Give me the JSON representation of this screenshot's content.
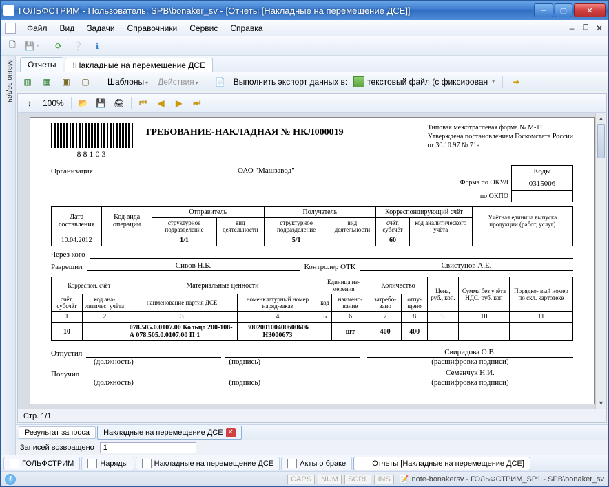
{
  "title": "ГОЛЬФСТРИМ - Пользователь: SPB\\bonaker_sv - [Отчеты  [Накладные на перемещение ДСЕ]]",
  "menu": {
    "file": "Файл",
    "view": "Вид",
    "tasks": "Задачи",
    "refs": "Справочники",
    "service": "Сервис",
    "help": "Справка"
  },
  "side_tab": "Меню задач",
  "upper_tabs": {
    "reports": "Отчеты",
    "invoices": "!Накладные на перемещение ДСЕ"
  },
  "tool": {
    "templates": "Шаблоны",
    "actions": "Действия",
    "export_label": "Выполнить экспорт данных в:",
    "export_target": "текстовый файл (с фиксирован"
  },
  "preview": {
    "zoom": "100%"
  },
  "doc": {
    "barcode_num": "88103",
    "title_prefix": "ТРЕБОВАНИЕ-НАКЛАДНАЯ №",
    "title_num": "НКЛ000019",
    "form_line1": "Типовая межотраслевая форма № М-11",
    "form_line2": "Утверждена постановлением Госкомстата России",
    "form_line3": "от 30.10.97 № 71а",
    "kody_head": "Коды",
    "okud_lbl": "Форма по ОКУД",
    "okud_val": "0315006",
    "okpo_lbl": "по ОКПО",
    "org_lbl": "Организация",
    "org_val": "ОАО \"Машзавод\"",
    "tbl1": {
      "h_date": "Дата составления",
      "h_opkind": "Код вида операции",
      "h_sender": "Отправитель",
      "h_recipient": "Получатель",
      "h_corr": "Корреспондирующий счёт",
      "h_output": "Учётная единица выпуска продукции (работ, услуг)",
      "h_struct": "структурное подразделение",
      "h_activity": "вид деятельности",
      "h_acct": "счёт, субсчёт",
      "h_analyt": "код аналитического учёта",
      "r": {
        "date": "10.04.2012",
        "op": "",
        "s_unit": "1/1",
        "s_act": "",
        "r_unit": "5/1",
        "r_act": "",
        "acct": "60",
        "an": "",
        "out": ""
      }
    },
    "via_lbl": "Через кого",
    "allowed_lbl": "Разрешил",
    "allowed_val": "Сивов Н.Б.",
    "otk_lbl": "Контролер ОТК",
    "otk_val": "Свистунов А.Е.",
    "tbl2": {
      "h_corr": "Корреспон. счёт",
      "h_mat": "Материальные ценности",
      "h_unit": "Единица из- мерения",
      "h_qty": "Количество",
      "h_price": "Цена, руб., коп.",
      "h_sum": "Сумма без учёта НДС, руб. коп",
      "h_ord": "Порядко- вый номер по скл. картотеке",
      "h_acct": "счёт, субсчёт",
      "h_an": "код ана- литичес. учёта",
      "h_name": "наименование партия ДСЕ",
      "h_nomen": "номенклатурный номер наряд-заказ",
      "h_code": "код",
      "h_uname": "наимено- вание",
      "h_req": "затребо- вано",
      "h_rel": "отпу- щено",
      "nums": [
        "1",
        "2",
        "3",
        "4",
        "5",
        "6",
        "7",
        "8",
        "9",
        "10",
        "11"
      ],
      "row": {
        "acct": "10",
        "an": "",
        "name": "078.505.0.0107.00 Кольцо 200-108-А 078.505.0.0107.00 П 1",
        "nomen": "300200100400600606 НЗ000673",
        "code": "",
        "uname": "шт",
        "req": "400",
        "rel": "400",
        "price": "",
        "sum": "",
        "ord": ""
      }
    },
    "released_lbl": "Отпустил",
    "received_lbl": "Получил",
    "hint_role": "(должность)",
    "hint_sign": "(подпись)",
    "hint_dec": "(расшифровка подписи)",
    "sign1": "Свиридова О.В.",
    "sign2": "Семенчук Н.И."
  },
  "pagebar": "Стр. 1/1",
  "lower_tabs": {
    "result": "Результат запроса",
    "inv": "Накладные на перемещение ДСЕ"
  },
  "result_bar": {
    "lbl": "Записей возвращено",
    "val": "1"
  },
  "window_tabs": {
    "t1": "ГОЛЬФСТРИМ",
    "t2": "Наряды",
    "t3": "Накладные на перемещение ДСЕ",
    "t4": "Акты о браке",
    "t5": "Отчеты  [Накладные на перемещение ДСЕ]"
  },
  "status": {
    "caps": "CAPS",
    "num": "NUM",
    "scrl": "SCRL",
    "ins": "INS",
    "tray": "note-bonakersv - ГОЛЬФСТРИМ_SP1 - SPB\\bonaker_sv"
  }
}
